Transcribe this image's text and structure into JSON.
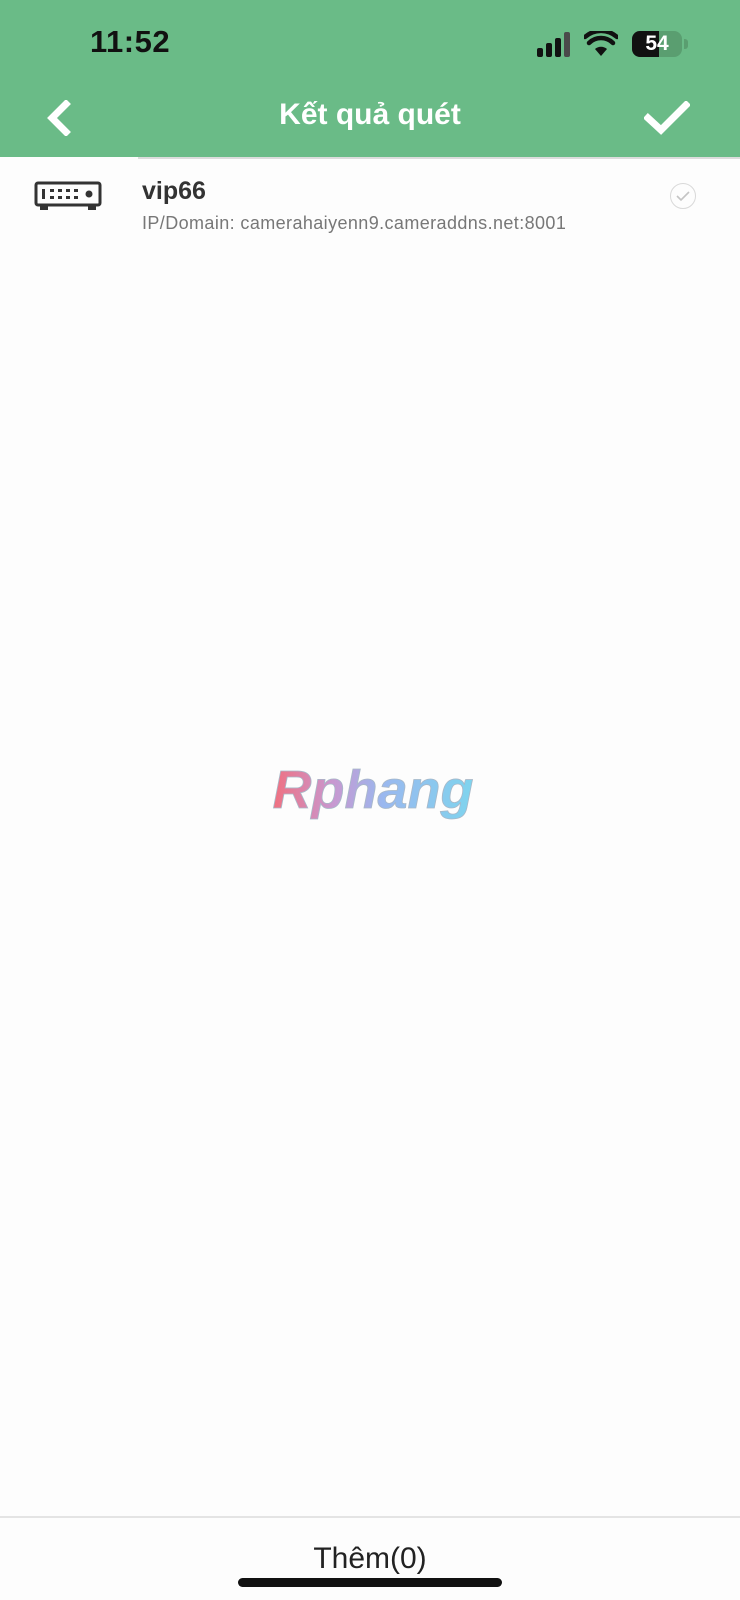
{
  "status_bar": {
    "time": "11:52",
    "battery": "54",
    "battery_level": 0.54,
    "icons": [
      "cellular-signal-icon",
      "wifi-icon",
      "battery-icon"
    ]
  },
  "nav": {
    "title": "Kết quả quét",
    "back_icon": "chevron-left-icon",
    "confirm_icon": "checkmark-icon"
  },
  "devices": [
    {
      "name": "vip66",
      "address": "IP/Domain: camerahaiyenn9.cameraddns.net:8001",
      "icon": "dvr-recorder-icon",
      "selected": false
    }
  ],
  "watermark": {
    "text": "Rphang"
  },
  "footer": {
    "add_label": "Thêm(0)"
  },
  "colors": {
    "header": "#6abb87",
    "title": "#ffffff",
    "background": "#fdfdfd"
  }
}
